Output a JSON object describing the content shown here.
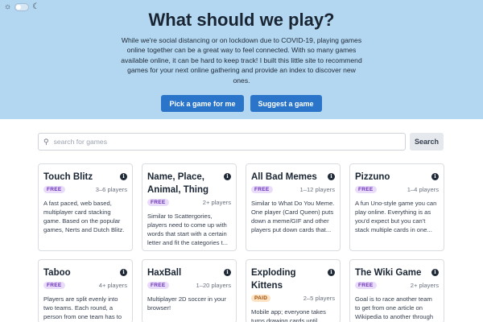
{
  "theme_toggle": {
    "light_icon": "sun-icon",
    "dark_icon": "moon-icon",
    "light_glyph": "☼",
    "dark_glyph": "☾"
  },
  "hero": {
    "title": "What should we play?",
    "intro": "While we're social distancing or on lockdown due to COVID-19, playing games online together can be a great way to feel connected. With so many games available online, it can be hard to keep track! I built this little site to recommend games for your next online gathering and provide an index to discover new ones.",
    "pick_button": "Pick a game for me",
    "suggest_button": "Suggest a game",
    "background_color": "#b3d7f0",
    "button_color": "#2a74c9"
  },
  "search": {
    "placeholder": "search for games",
    "value": "",
    "button": "Search",
    "icon": "search-icon",
    "glyph": "⚲"
  },
  "info_glyph": "i",
  "games": [
    {
      "title": "Touch Blitz",
      "price": "FREE",
      "players": "3–6 players",
      "description": "A fast paced, web based, multiplayer card stacking game. Based on the popular games, Nerts and Dutch Blitz."
    },
    {
      "title": "Name, Place, Animal, Thing",
      "price": "FREE",
      "players": "2+ players",
      "description": "Similar to Scattergories, players need to come up with words that start with a certain letter and fit the categories t..."
    },
    {
      "title": "All Bad Memes",
      "price": "FREE",
      "players": "1–12 players",
      "description": "Similar to What Do You Meme. One player (Card Queen) puts down a meme/GIF and other players put down cards that..."
    },
    {
      "title": "Pizzuno",
      "price": "FREE",
      "players": "1–4 players",
      "description": "A fun Uno-style game you can play online. Everything is as you'd expect but you can't stack multiple cards in one..."
    },
    {
      "title": "Taboo",
      "price": "FREE",
      "players": "4+ players",
      "description": "Players are split evenly into two teams. Each round, a person from one team has to"
    },
    {
      "title": "HaxBall",
      "price": "FREE",
      "players": "1–20 players",
      "description": "Multiplayer 2D soccer in your browser!"
    },
    {
      "title": "Exploding Kittens",
      "price": "PAID",
      "players": "2–5 players",
      "description": "Mobile app; everyone takes turns drawing cards until"
    },
    {
      "title": "The Wiki Game",
      "price": "FREE",
      "players": "2+ players",
      "description": "Goal is to race another team to get from one article on Wikipedia to another through"
    }
  ]
}
